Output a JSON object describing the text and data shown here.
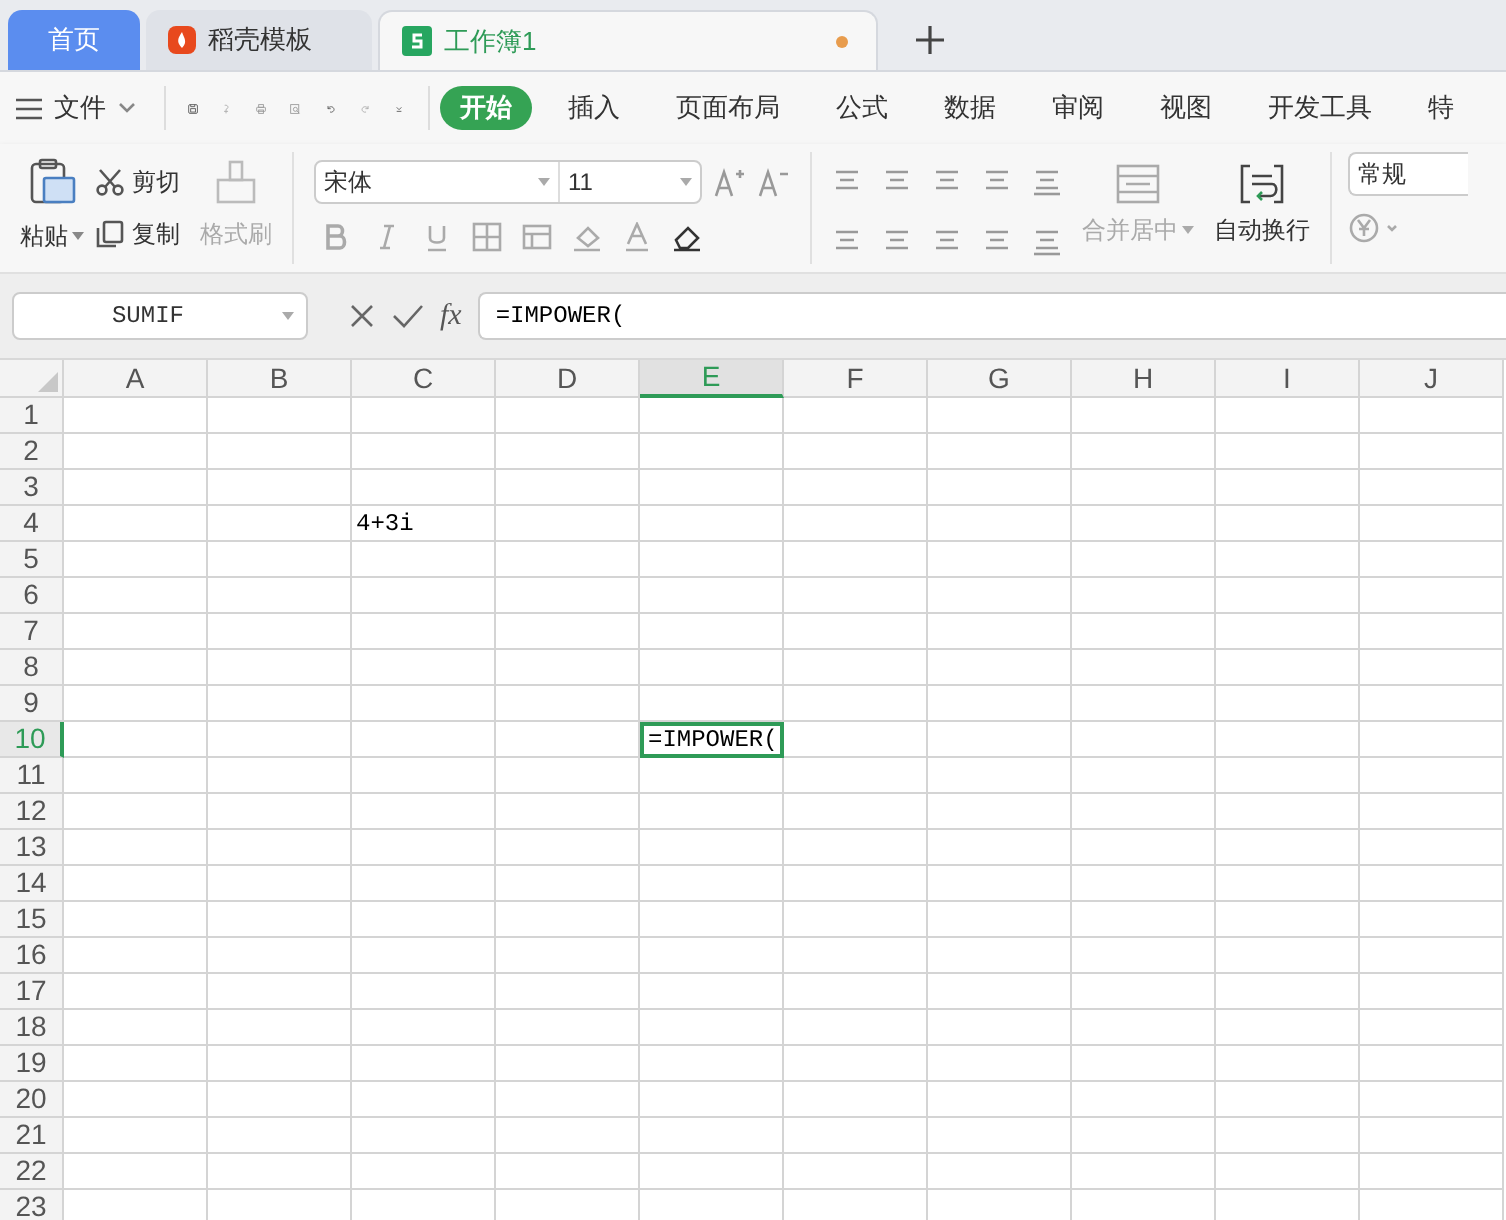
{
  "tabs": [
    {
      "label": "首页",
      "kind": "home",
      "selected": false
    },
    {
      "label": "稻壳模板",
      "kind": "docer",
      "selected": false
    },
    {
      "label": "工作簿1",
      "kind": "sheet",
      "selected": true,
      "unsaved": true
    }
  ],
  "menu": {
    "file": "文件",
    "ribbon_tabs": [
      {
        "label": "开始",
        "selected": true
      },
      {
        "label": "插入",
        "selected": false
      },
      {
        "label": "页面布局",
        "selected": false
      },
      {
        "label": "公式",
        "selected": false
      },
      {
        "label": "数据",
        "selected": false
      },
      {
        "label": "审阅",
        "selected": false
      },
      {
        "label": "视图",
        "selected": false
      },
      {
        "label": "开发工具",
        "selected": false
      },
      {
        "label": "特",
        "selected": false
      }
    ]
  },
  "ribbon": {
    "paste": "粘贴",
    "cut": "剪切",
    "copy": "复制",
    "format_painter": {
      "label": "格式刷",
      "disabled": true
    },
    "font": "宋体",
    "font_size": "11",
    "merge": {
      "label": "合并居中",
      "disabled": true
    },
    "wrap": {
      "label": "自动换行",
      "disabled": false
    },
    "number_format": "常规"
  },
  "formula_bar": {
    "name_box": "SUMIF",
    "fx": "fx",
    "formula": "=IMPOWER("
  },
  "sheet": {
    "columns": [
      "A",
      "B",
      "C",
      "D",
      "E",
      "F",
      "G",
      "H",
      "I",
      "J"
    ],
    "rows": [
      {
        "label": "1"
      },
      {
        "label": "2"
      },
      {
        "label": "3"
      },
      {
        "label": "4",
        "cells": [
          null,
          null,
          {
            "text": "4+3i",
            "selected": false
          }
        ]
      },
      {
        "label": "5"
      },
      {
        "label": "6"
      },
      {
        "label": "7"
      },
      {
        "label": "8"
      },
      {
        "label": "9"
      },
      {
        "label": "10",
        "cells": [
          null,
          null,
          null,
          null,
          {
            "text": "=IMPOWER(",
            "selected": true
          }
        ]
      },
      {
        "label": "11"
      },
      {
        "label": "12"
      },
      {
        "label": "13"
      },
      {
        "label": "14"
      },
      {
        "label": "15"
      },
      {
        "label": "16"
      },
      {
        "label": "17"
      },
      {
        "label": "18"
      },
      {
        "label": "19"
      },
      {
        "label": "20"
      },
      {
        "label": "21"
      },
      {
        "label": "22"
      },
      {
        "label": "23"
      }
    ]
  }
}
